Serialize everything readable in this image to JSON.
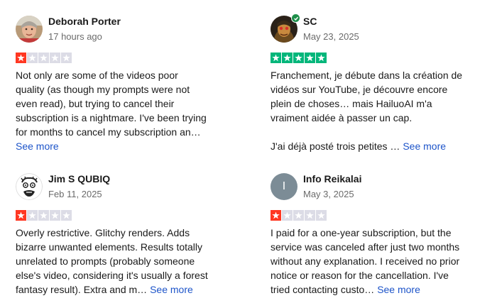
{
  "reviews": [
    {
      "name": "Deborah Porter",
      "date": "17 hours ago",
      "rating": 1,
      "avatar": "photo-avatar",
      "lines": [
        "Not only are some of the videos poor",
        "quality (as though my prompts were not",
        "even read), but trying to cancel their",
        "subscription is a nightmare. I've been trying",
        "for months to cancel my subscription an…"
      ],
      "tail": "",
      "more": "See more"
    },
    {
      "name": "SC",
      "date": "May 23, 2025",
      "rating": 5,
      "avatar": "photo-avatar-verified",
      "lines": [
        "Franchement, je débute dans la création de",
        "vidéos sur YouTube, je découvre encore",
        "plein de choses… mais HailuoAI m'a",
        "vraiment aidée à passer un cap."
      ],
      "tail": "J'ai déjà posté trois petites …",
      "more": "See more"
    },
    {
      "name": "Jim S QUBIQ",
      "date": "Feb 11, 2025",
      "rating": 1,
      "avatar": "cartoon-face-avatar",
      "lines": [
        "Overly restrictive. Glitchy renders. Adds",
        "bizarre unwanted elements. Results totally",
        "unrelated to prompts (probably someone",
        "else's video, considering it's usually a forest"
      ],
      "tail": "fantasy result). Extra and m…",
      "more": "See more"
    },
    {
      "name": "Info Reikalai",
      "date": "May 3, 2025",
      "rating": 1,
      "avatar": "initial-avatar",
      "initial": "I",
      "lines": [
        "I paid for a one-year subscription, but the",
        "service was canceled after just two months",
        "without any explanation. I received no prior",
        "notice or reason for the cancellation. I've"
      ],
      "tail": "tried contacting custo…",
      "more": "See more"
    }
  ],
  "colors": {
    "star_one": "#ff3722",
    "star_five": "#00b67a",
    "star_empty": "#dcdce6",
    "link": "#1d54c9",
    "initial_avatar_bg": "#7c8c96"
  }
}
